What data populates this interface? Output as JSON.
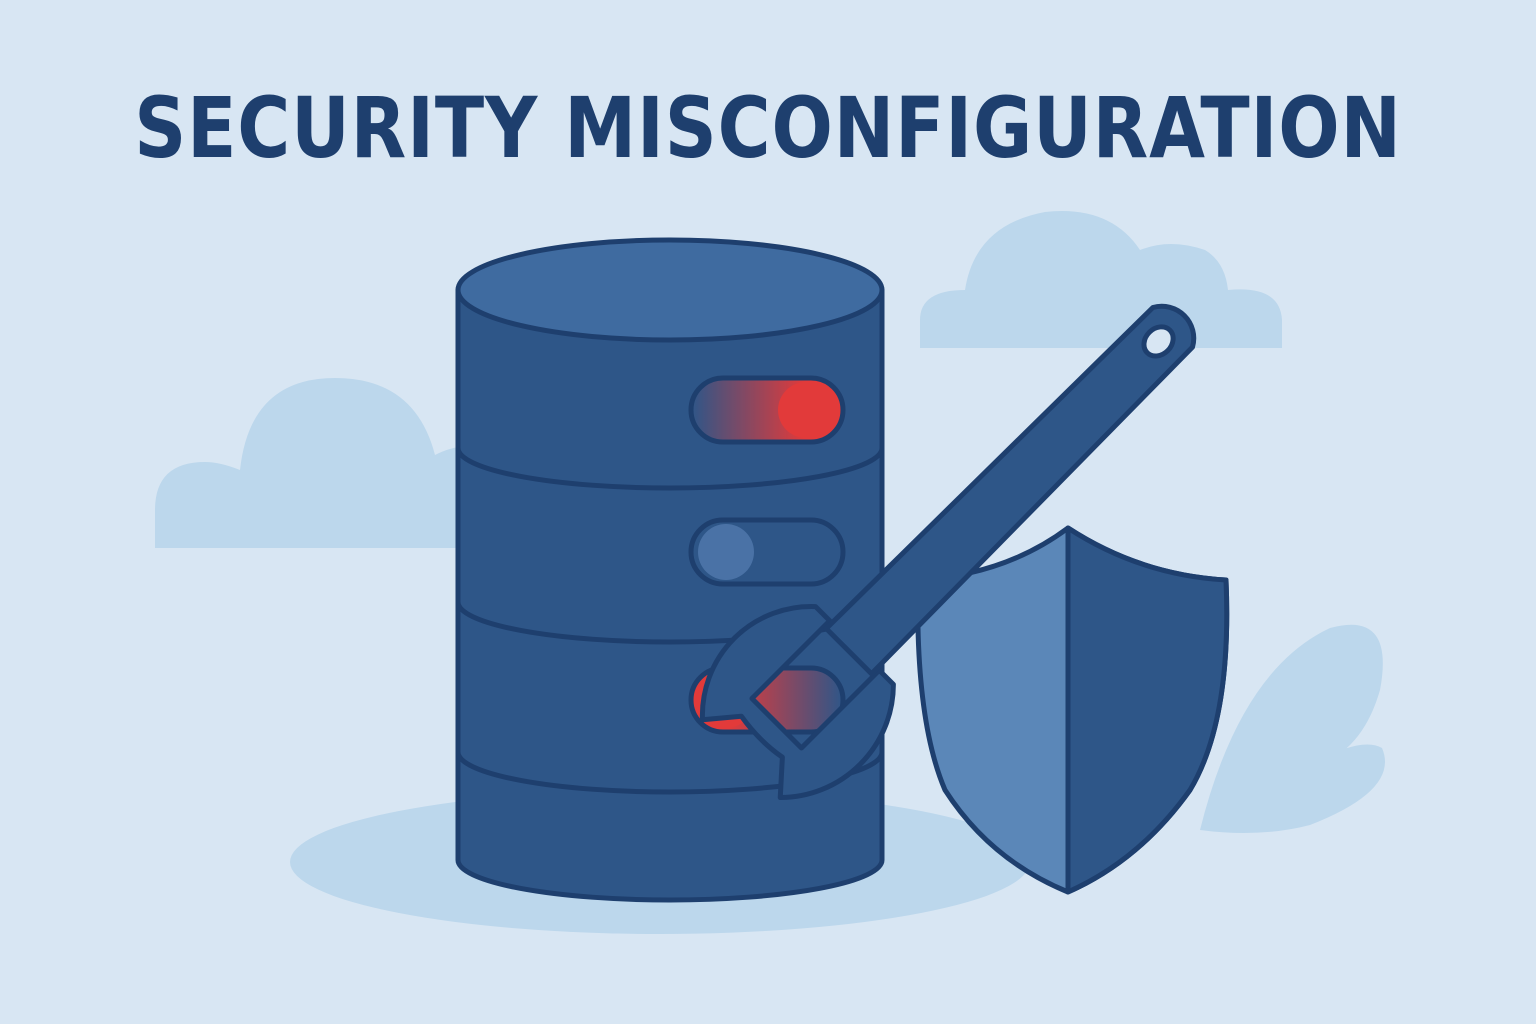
{
  "headline": "SECURITY MISCONFIGURATION",
  "colors": {
    "background": "#d8e6f3",
    "cloud": "#bcd7ec",
    "outline": "#1e3f6e",
    "server_body": "#2e5688",
    "server_top": "#3f6ba0",
    "shield_light": "#5b87b8",
    "shield_dark": "#2e5688",
    "alert_red": "#e23a3a",
    "toggle_off": "#4a72a6"
  },
  "icons": [
    "database-server-icon",
    "wrench-icon",
    "shield-icon",
    "cloud-icon"
  ],
  "toggles": [
    {
      "state": "misconfigured",
      "color": "alert_red"
    },
    {
      "state": "off",
      "color": "toggle_off"
    },
    {
      "state": "misconfigured",
      "color": "alert_red"
    }
  ]
}
